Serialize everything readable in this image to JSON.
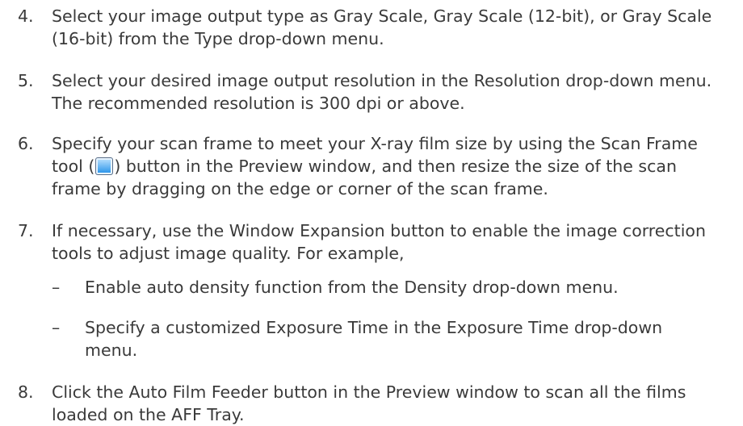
{
  "steps": [
    {
      "number": "4.",
      "text": "Select your image output type as Gray Scale, Gray Scale (12-bit), or Gray Scale (16-bit) from the Type drop-down menu."
    },
    {
      "number": "5.",
      "text": "Select your desired image output resolution in the Resolution drop-down menu. The recommended resolution is 300 dpi or above."
    },
    {
      "number": "6.",
      "text_before_icon": "Specify your scan frame to meet your X-ray film size by using the Scan Frame tool (",
      "icon": "scan-frame-icon",
      "text_after_icon": ") button in the Preview window, and then resize the size of the scan frame by dragging on the edge or corner of the scan frame."
    },
    {
      "number": "7.",
      "text": "If necessary, use the Window Expansion button to enable the image correction tools to adjust image quality. For example,",
      "subitems": [
        {
          "dash": "–",
          "text": "Enable auto density function from the Density drop-down menu."
        },
        {
          "dash": "–",
          "text": "Specify a customized Exposure Time in the Exposure Time drop-down menu."
        }
      ]
    },
    {
      "number": "8.",
      "text": "Click the Auto Film Feeder button in the Preview window to scan all the films loaded on the AFF Tray."
    }
  ]
}
